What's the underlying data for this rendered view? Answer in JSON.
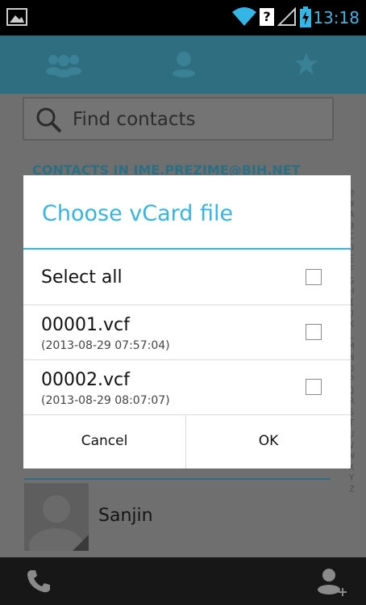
{
  "status_bar": {
    "time": "13:18",
    "icons": [
      "image-notification-icon",
      "wifi-icon",
      "sim-missing-icon",
      "signal-icon",
      "battery-charging-icon"
    ]
  },
  "tabs": {
    "items": [
      "group-icon",
      "person-icon",
      "star-icon"
    ],
    "selected": 1
  },
  "search": {
    "placeholder": "Find contacts"
  },
  "section_header": "CONTACTS IN IME.PREZIME@BIH.NET",
  "alphabet": [
    "@",
    "#",
    "A",
    "B",
    "C",
    "D",
    "E",
    "F",
    "G",
    "H",
    "I",
    "J",
    "K",
    "L",
    "M",
    "N",
    "O",
    "P",
    "Q",
    "R",
    "S",
    "T",
    "U",
    "V",
    "W",
    "X",
    "Y",
    "Z"
  ],
  "contact": {
    "name": "Sanjin"
  },
  "dialog": {
    "title": "Choose vCard file",
    "select_all": "Select all",
    "files": [
      {
        "name": "00001.vcf",
        "date": "(2013-08-29 07:57:04)"
      },
      {
        "name": "00002.vcf",
        "date": "(2013-08-29 08:07:07)"
      }
    ],
    "cancel": "Cancel",
    "ok": "OK"
  },
  "colors": {
    "accent": "#33b5e5"
  }
}
